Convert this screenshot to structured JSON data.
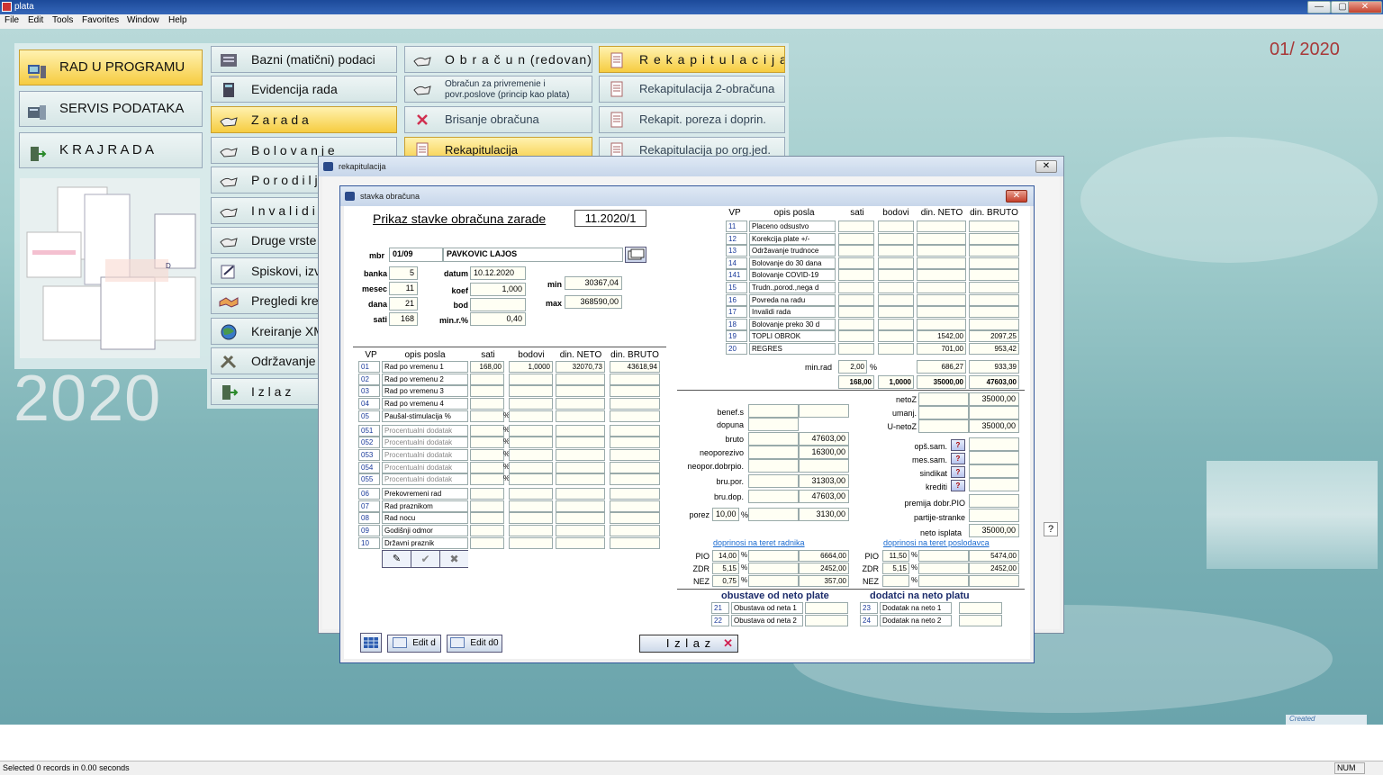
{
  "app": {
    "title": "plata",
    "period": "01/ 2020",
    "year_big": "2020",
    "created": "Created",
    "tb_min": "—",
    "tb_max": "▢",
    "tb_close": "✕"
  },
  "menu": [
    "File",
    "Edit",
    "Tools",
    "Favorites",
    "Window",
    "Help"
  ],
  "main_buttons": [
    "RAD  U  PROGRAMU",
    "SERVIS PODATAKA",
    "K R A J   R A D A"
  ],
  "col2": [
    "Bazni (matični) podaci",
    "Evidencija rada",
    "Z a r a d a",
    "B o l o v a n j e",
    "P o r o d i l j",
    "I n v a l i d i",
    "Druge vrste",
    "Spiskovi, izve",
    "Pregledi kred",
    "Kreiranje XML",
    "Održavanje p",
    "I z l a z"
  ],
  "col3": [
    "O b r a č u n   (redovan)",
    "Obračun za privremenie i povr.poslove (princip kao plata)",
    "Brisanje obračuna",
    "Rekapitulacija"
  ],
  "col4": [
    "R e k a p i t u l a c i j a",
    "Rekapitulacija  2-obračuna",
    "Rekapit. poreza i doprin.",
    "Rekapitulacija po org.jed."
  ],
  "status": {
    "text": "Selected 0 records in 0.00 seconds",
    "num": "NUM"
  },
  "rekap_window": {
    "title": "rekapitulacija",
    "close": "✕",
    "help": "?"
  },
  "stavka": {
    "title": "stavka obračuna",
    "close": "✕",
    "heading": "Prikaz stavke obračuna zarade",
    "period": "11.2020/1",
    "mbr_label": "mbr",
    "mbr": "01/09",
    "name": "PAVKOVIC LAJOS",
    "labels": {
      "banka": "banka",
      "mesec": "mesec",
      "dana": "dana",
      "sati": "sati",
      "datum": "datum",
      "koef": "koef",
      "bod": "bod",
      "minr": "min.r.%",
      "min": "min",
      "max": "max"
    },
    "values": {
      "banka": "5",
      "mesec": "11",
      "dana": "21",
      "sati": "168",
      "datum": "10.12.2020",
      "koef": "1,000",
      "bod": "",
      "minr": "0,40",
      "min": "30367,04",
      "max": "368590,00"
    },
    "cols": [
      "VP",
      "opis posla",
      "sati",
      "bodovi",
      "din. NETO",
      "din. BRUTO"
    ],
    "left_rows": [
      {
        "vp": "01",
        "op": "Rad po vremenu 1",
        "sati": "168,00",
        "bod": "1,0000",
        "neto": "32070,73",
        "bruto": "43618,94",
        "pct": ""
      },
      {
        "vp": "02",
        "op": "Rad po vremenu 2",
        "sati": "",
        "bod": "",
        "neto": "",
        "bruto": "",
        "pct": ""
      },
      {
        "vp": "03",
        "op": "Rad po vremenu 3",
        "sati": "",
        "bod": "",
        "neto": "",
        "bruto": "",
        "pct": ""
      },
      {
        "vp": "04",
        "op": "Rad po vremenu 4",
        "sati": "",
        "bod": "",
        "neto": "",
        "bruto": "",
        "pct": ""
      },
      {
        "vp": "05",
        "op": "Paušal-stimulacija %",
        "sati": "",
        "bod": "",
        "neto": "",
        "bruto": "",
        "pct": "%"
      },
      {
        "vp": "051",
        "op": "Procentualni dodatak",
        "sati": "",
        "bod": "",
        "neto": "",
        "bruto": "",
        "pct": "%"
      },
      {
        "vp": "052",
        "op": "Procentualni dodatak",
        "sati": "",
        "bod": "",
        "neto": "",
        "bruto": "",
        "pct": "%"
      },
      {
        "vp": "053",
        "op": "Procentualni dodatak",
        "sati": "",
        "bod": "",
        "neto": "",
        "bruto": "",
        "pct": "%"
      },
      {
        "vp": "054",
        "op": "Procentualni dodatak",
        "sati": "",
        "bod": "",
        "neto": "",
        "bruto": "",
        "pct": "%"
      },
      {
        "vp": "055",
        "op": "Procentualni dodatak",
        "sati": "",
        "bod": "",
        "neto": "",
        "bruto": "",
        "pct": "%"
      },
      {
        "vp": "06",
        "op": "Prekovremeni rad",
        "sati": "",
        "bod": "",
        "neto": "",
        "bruto": "",
        "pct": ""
      },
      {
        "vp": "07",
        "op": "Rad praznikom",
        "sati": "",
        "bod": "",
        "neto": "",
        "bruto": "",
        "pct": ""
      },
      {
        "vp": "08",
        "op": "Rad nocu",
        "sati": "",
        "bod": "",
        "neto": "",
        "bruto": "",
        "pct": ""
      },
      {
        "vp": "09",
        "op": "Godišnji odmor",
        "sati": "",
        "bod": "",
        "neto": "",
        "bruto": "",
        "pct": ""
      },
      {
        "vp": "10",
        "op": "Državni praznik",
        "sati": "",
        "bod": "",
        "neto": "",
        "bruto": "",
        "pct": ""
      }
    ],
    "right_rows": [
      {
        "vp": "11",
        "op": "Placeno odsustvo",
        "neto": "",
        "bruto": ""
      },
      {
        "vp": "12",
        "op": "Korekcija plate +/-",
        "neto": "",
        "bruto": ""
      },
      {
        "vp": "13",
        "op": "Održavanje trudnoce",
        "neto": "",
        "bruto": ""
      },
      {
        "vp": "14",
        "op": "Bolovanje do 30 dana",
        "neto": "",
        "bruto": ""
      },
      {
        "vp": "141",
        "op": "Bolovanje COVID-19",
        "neto": "",
        "bruto": ""
      },
      {
        "vp": "15",
        "op": "Trudn.,porod.,nega d",
        "neto": "",
        "bruto": ""
      },
      {
        "vp": "16",
        "op": "Povreda na radu",
        "neto": "",
        "bruto": ""
      },
      {
        "vp": "17",
        "op": "Invalidi rada",
        "neto": "",
        "bruto": ""
      },
      {
        "vp": "18",
        "op": "Bolovanje preko 30 d",
        "neto": "",
        "bruto": ""
      },
      {
        "vp": "19",
        "op": "TOPLI OBROK",
        "neto": "1542,00",
        "bruto": "2097,25"
      },
      {
        "vp": "20",
        "op": "REGRES",
        "neto": "701,00",
        "bruto": "953,42"
      }
    ],
    "minrad": {
      "label": "min.rad",
      "pct": "2,00",
      "neto": "686,27",
      "bruto": "933,39"
    },
    "totals": {
      "sati": "168,00",
      "bod": "1,0000",
      "neto": "35000,00",
      "bruto": "47603,00"
    },
    "calc": {
      "benefs": "benef.s",
      "dopuna": "dopuna",
      "bruto_l": "bruto",
      "bruto": "47603,00",
      "neopor_l": "neoporezivo",
      "neopor": "16300,00",
      "neopordob_l": "neopor.dobrpio.",
      "brupor_l": "bru.por.",
      "brupor": "31303,00",
      "brudop_l": "bru.dop.",
      "brudop": "47603,00",
      "porez_l": "porez",
      "porez_pct": "10,00",
      "porez": "3130,00",
      "netoz_l": "netoZ",
      "netoz": "35000,00",
      "umanj_l": "umanj.",
      "unetoz_l": "U-netoZ",
      "unetoz": "35000,00",
      "opssam_l": "opš.sam.",
      "messam_l": "mes.sam.",
      "sindikat_l": "sindikat",
      "krediti_l": "krediti",
      "premija_l": "premija dobr.PIO",
      "partije_l": "partije-stranke",
      "netoisplata_l": "neto isplata",
      "netoisplata": "35000,00",
      "q": "?"
    },
    "dopr_radnik_title": "doprinosi na teret radnika",
    "dopr_poslodavac_title": "doprinosi na teret poslodavca",
    "dopr_radnik": [
      {
        "lbl": "PIO",
        "pct": "14,00",
        "val": "6664,00"
      },
      {
        "lbl": "ZDR",
        "pct": "5,15",
        "val": "2452,00"
      },
      {
        "lbl": "NEZ",
        "pct": "0,75",
        "val": "357,00"
      }
    ],
    "dopr_poslodavac": [
      {
        "lbl": "PIO",
        "pct": "11,50",
        "val": "5474,00"
      },
      {
        "lbl": "ZDR",
        "pct": "5,15",
        "val": "2452,00"
      },
      {
        "lbl": "NEZ",
        "pct": "",
        "val": ""
      }
    ],
    "obustave_title": "obustave od neto plate",
    "dodatci_title": "dodatci na neto platu",
    "obustave": [
      {
        "vp": "21",
        "op": "Obustava od neta 1"
      },
      {
        "vp": "22",
        "op": "Obustava od neta 2"
      }
    ],
    "dodatci": [
      {
        "vp": "23",
        "op": "Dodatak na neto 1"
      },
      {
        "vp": "24",
        "op": "Dodatak na neto 2"
      }
    ],
    "pct_sign": "%",
    "btn_edit_d": "Edit d",
    "btn_edit_d0": "Edit d0",
    "btn_izlaz": "I z l a z"
  }
}
